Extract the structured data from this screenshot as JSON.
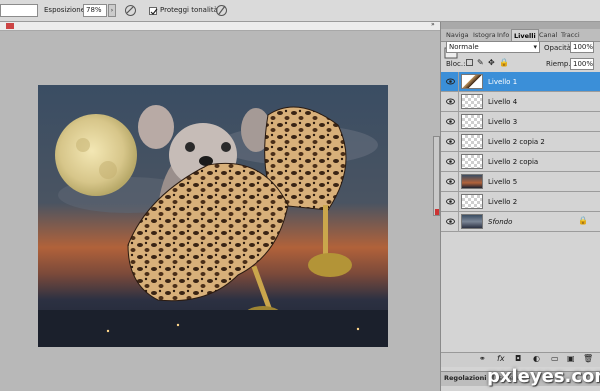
{
  "options_bar": {
    "exposure_label": "Esposizione:",
    "exposure_value": "78%",
    "protect_label": "Proteggi tonalità",
    "protect_checked": true
  },
  "layers_panel": {
    "tabs": [
      "Naviga",
      "Istogra",
      "Info",
      "Livelli",
      "Canal",
      "Tracci"
    ],
    "active_tab": "Livelli",
    "blend_mode": "Normale",
    "opacity_label": "Opacità:",
    "opacity_value": "100%",
    "lock_label": "Bloc.:",
    "fill_label": "Riemp.:",
    "fill_value": "100%",
    "layers": [
      {
        "name": "Livello 1",
        "selected": true,
        "visible": true,
        "italic": false
      },
      {
        "name": "Livello 4",
        "selected": false,
        "visible": true,
        "italic": false
      },
      {
        "name": "Livello 3",
        "selected": false,
        "visible": true,
        "italic": false
      },
      {
        "name": "Livello 2 copia 2",
        "selected": false,
        "visible": true,
        "italic": false
      },
      {
        "name": "Livello 2 copia",
        "selected": false,
        "visible": true,
        "italic": false
      },
      {
        "name": "Livello 5",
        "selected": false,
        "visible": true,
        "italic": false
      },
      {
        "name": "Livello 2",
        "selected": false,
        "visible": true,
        "italic": false
      },
      {
        "name": "Sfondo",
        "selected": false,
        "visible": true,
        "italic": true
      }
    ],
    "bottom_tabs": [
      "Regolazioni",
      "Maschere"
    ]
  },
  "watermark": "pxleyes.com",
  "colors": {
    "selection": "#3b8fd8",
    "panel_bg": "#d4d4d4",
    "workspace": "#b8b8b8"
  }
}
